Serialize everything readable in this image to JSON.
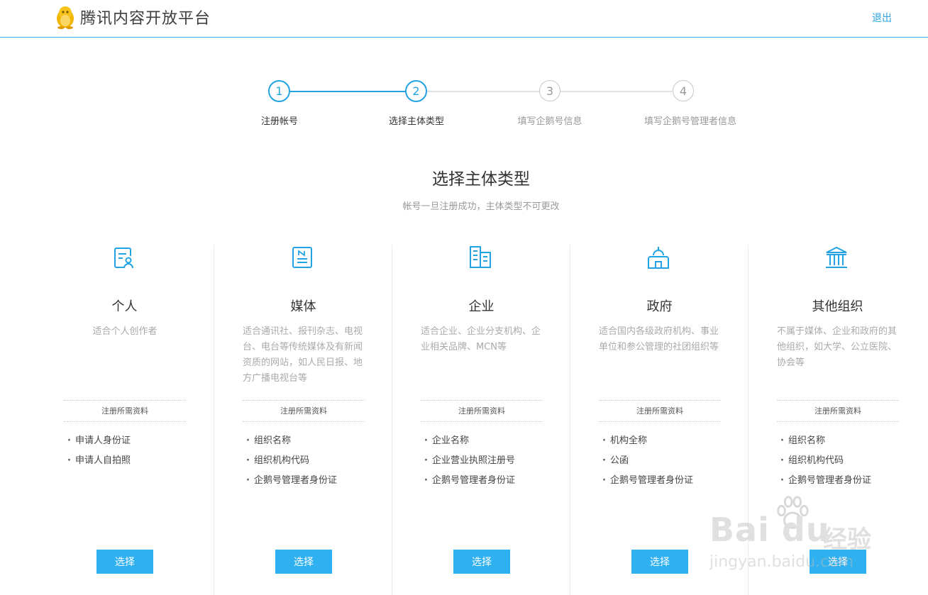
{
  "header": {
    "brand": "腾讯内容开放平台",
    "logout_label": "退出"
  },
  "steps": [
    {
      "number": "1",
      "label": "注册帐号",
      "state": "done"
    },
    {
      "number": "2",
      "label": "选择主体类型",
      "state": "active"
    },
    {
      "number": "3",
      "label": "填写企鹅号信息",
      "state": "pending"
    },
    {
      "number": "4",
      "label": "填写企鹅号管理者信息",
      "state": "pending"
    }
  ],
  "section": {
    "title": "选择主体类型",
    "subtitle": "帐号一旦注册成功，主体类型不可更改"
  },
  "cards": [
    {
      "icon": "person-card-icon",
      "title": "个人",
      "desc": "适合个人创作者",
      "req_head": "注册所需资料",
      "reqs": [
        "申请人身份证",
        "申请人自拍照"
      ],
      "button": "选择"
    },
    {
      "icon": "newspaper-icon",
      "title": "媒体",
      "desc": "适合通讯社、报刊杂志、电视台、电台等传统媒体及有新闻资质的网站，如人民日报、地方广播电视台等",
      "req_head": "注册所需资料",
      "reqs": [
        "组织名称",
        "组织机构代码",
        "企鹅号管理者身份证"
      ],
      "button": "选择"
    },
    {
      "icon": "building-icon",
      "title": "企业",
      "desc": "适合企业、企业分支机构、企业相关品牌、MCN等",
      "req_head": "注册所需资料",
      "reqs": [
        "企业名称",
        "企业营业执照注册号",
        "企鹅号管理者身份证"
      ],
      "button": "选择"
    },
    {
      "icon": "government-icon",
      "title": "政府",
      "desc": "适合国内各级政府机构、事业单位和参公管理的社团组织等",
      "req_head": "注册所需资料",
      "reqs": [
        "机构全称",
        "公函",
        "企鹅号管理者身份证"
      ],
      "button": "选择"
    },
    {
      "icon": "institution-icon",
      "title": "其他组织",
      "desc": "不属于媒体、企业和政府的其他组织，如大学、公立医院、协会等",
      "req_head": "注册所需资料",
      "reqs": [
        "组织名称",
        "组织机构代码",
        "企鹅号管理者身份证"
      ],
      "button": "选择"
    }
  ],
  "watermark": {
    "brand": "Bai du",
    "jingyan": "经验",
    "url": "jingyan.baidu.com"
  }
}
